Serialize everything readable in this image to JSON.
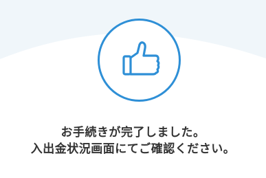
{
  "completion": {
    "icon": "thumbs-up-icon",
    "message_line1": "お手続きが完了しました。",
    "message_line2": "入出金状況画面にてご確認ください。"
  },
  "colors": {
    "accent": "#2e8fd6",
    "text": "#333333",
    "background_wave": "#f0f6fa"
  }
}
